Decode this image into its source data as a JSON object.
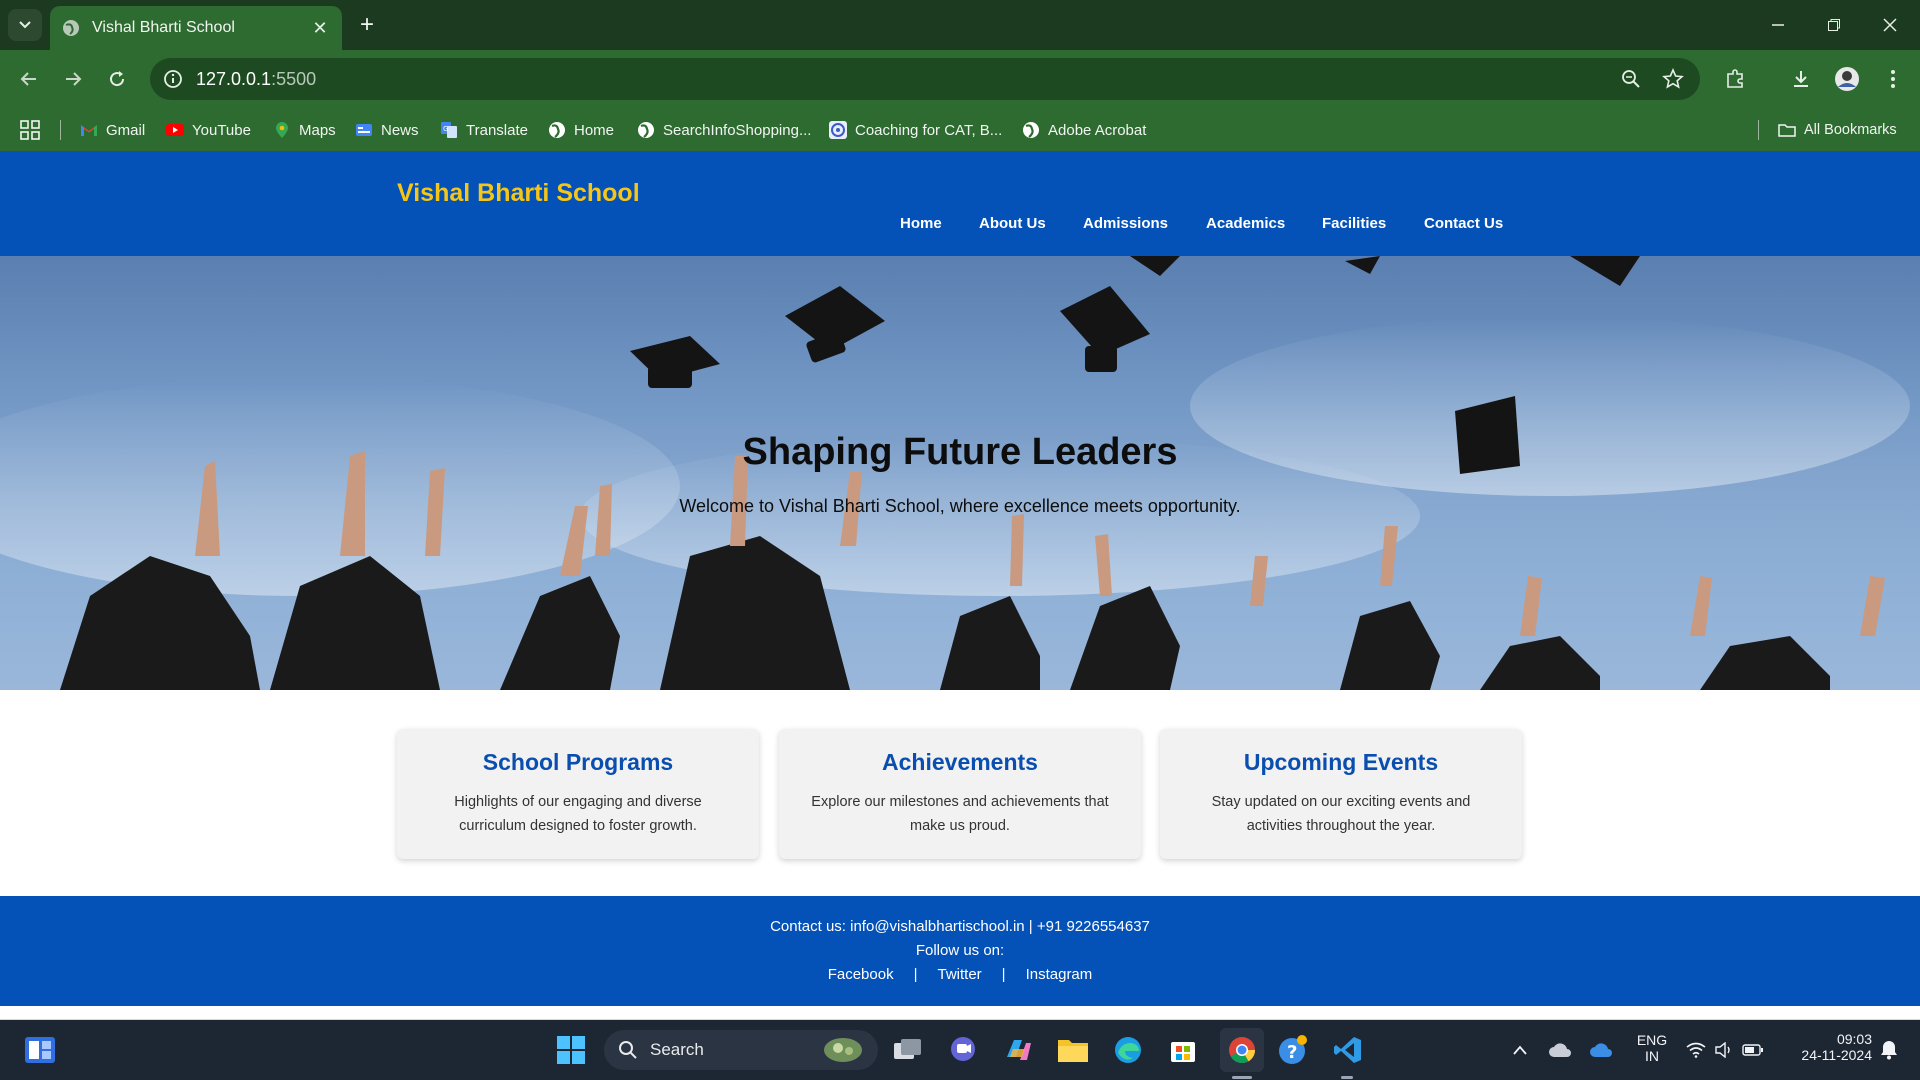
{
  "browser": {
    "tab_title": "Vishal Bharti School",
    "url_host": "127.0.0.1",
    "url_port": ":5500",
    "bookmarks": [
      {
        "label": "Gmail",
        "icon": "gmail-icon"
      },
      {
        "label": "YouTube",
        "icon": "youtube-icon"
      },
      {
        "label": "Maps",
        "icon": "maps-icon"
      },
      {
        "label": "News",
        "icon": "news-icon"
      },
      {
        "label": "Translate",
        "icon": "translate-icon"
      },
      {
        "label": "Home",
        "icon": "globe-icon"
      },
      {
        "label": "SearchInfoShopping...",
        "icon": "globe-icon"
      },
      {
        "label": "Coaching for CAT, B...",
        "icon": "coaching-icon"
      },
      {
        "label": "Adobe Acrobat",
        "icon": "globe-icon"
      }
    ],
    "all_bookmarks": "All Bookmarks",
    "colors": {
      "frame": "#1c3a1f",
      "toolbar": "#2e6b30"
    }
  },
  "site": {
    "logo": "Vishal Bharti School",
    "nav": [
      "Home",
      "About Us",
      "Admissions",
      "Academics",
      "Facilities",
      "Contact Us"
    ],
    "hero": {
      "title": "Shaping Future Leaders",
      "subtitle": "Welcome to Vishal Bharti School, where excellence meets opportunity."
    },
    "cards": [
      {
        "title": "School Programs",
        "text": "Highlights of our engaging and diverse curriculum designed to foster growth."
      },
      {
        "title": "Achievements",
        "text": "Explore our milestones and achievements that make us proud."
      },
      {
        "title": "Upcoming Events",
        "text": "Stay updated on our exciting events and activities throughout the year."
      }
    ],
    "footer": {
      "contact": "Contact us: info@vishalbhartischool.in | +91 9226554637",
      "follow": "Follow us on:",
      "links": [
        "Facebook",
        "Twitter",
        "Instagram"
      ],
      "separator": "|"
    },
    "colors": {
      "header": "#0452b8",
      "logo": "#f5c518",
      "card_title": "#0a4fb0"
    }
  },
  "taskbar": {
    "search_label": "Search",
    "language": "ENG",
    "region": "IN",
    "time": "09:03",
    "date": "24-11-2024"
  }
}
